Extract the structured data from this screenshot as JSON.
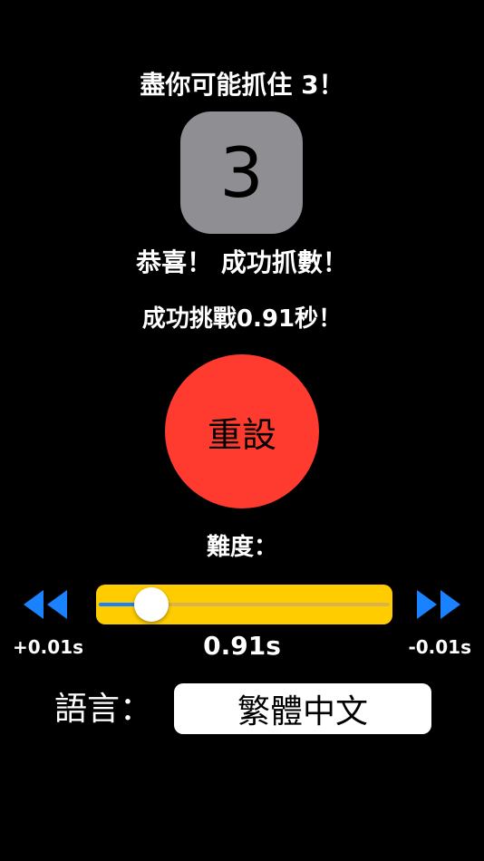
{
  "game": {
    "instruction": "盡你可能抓住 3！",
    "number": "3",
    "result": "恭喜！ 成功抓數！",
    "time_message": "成功挑戰0.91秒！",
    "reset_label": "重設"
  },
  "difficulty": {
    "label": "難度：",
    "value_text": "0.91s",
    "slider_fraction": 0.18,
    "left_step": "+0.01s",
    "right_step": "-0.01s"
  },
  "language": {
    "label": "語言：",
    "selected": "繁體中文"
  },
  "colors": {
    "background": "#000000",
    "number_box": "#8e8e93",
    "reset_button": "#ff3b30",
    "slider_bg": "#ffcc00",
    "slider_fill": "#1a82ff",
    "step_icon": "#1a82ff"
  },
  "icons": {
    "rewind": "rewind-icon",
    "forward": "fast-forward-icon"
  }
}
